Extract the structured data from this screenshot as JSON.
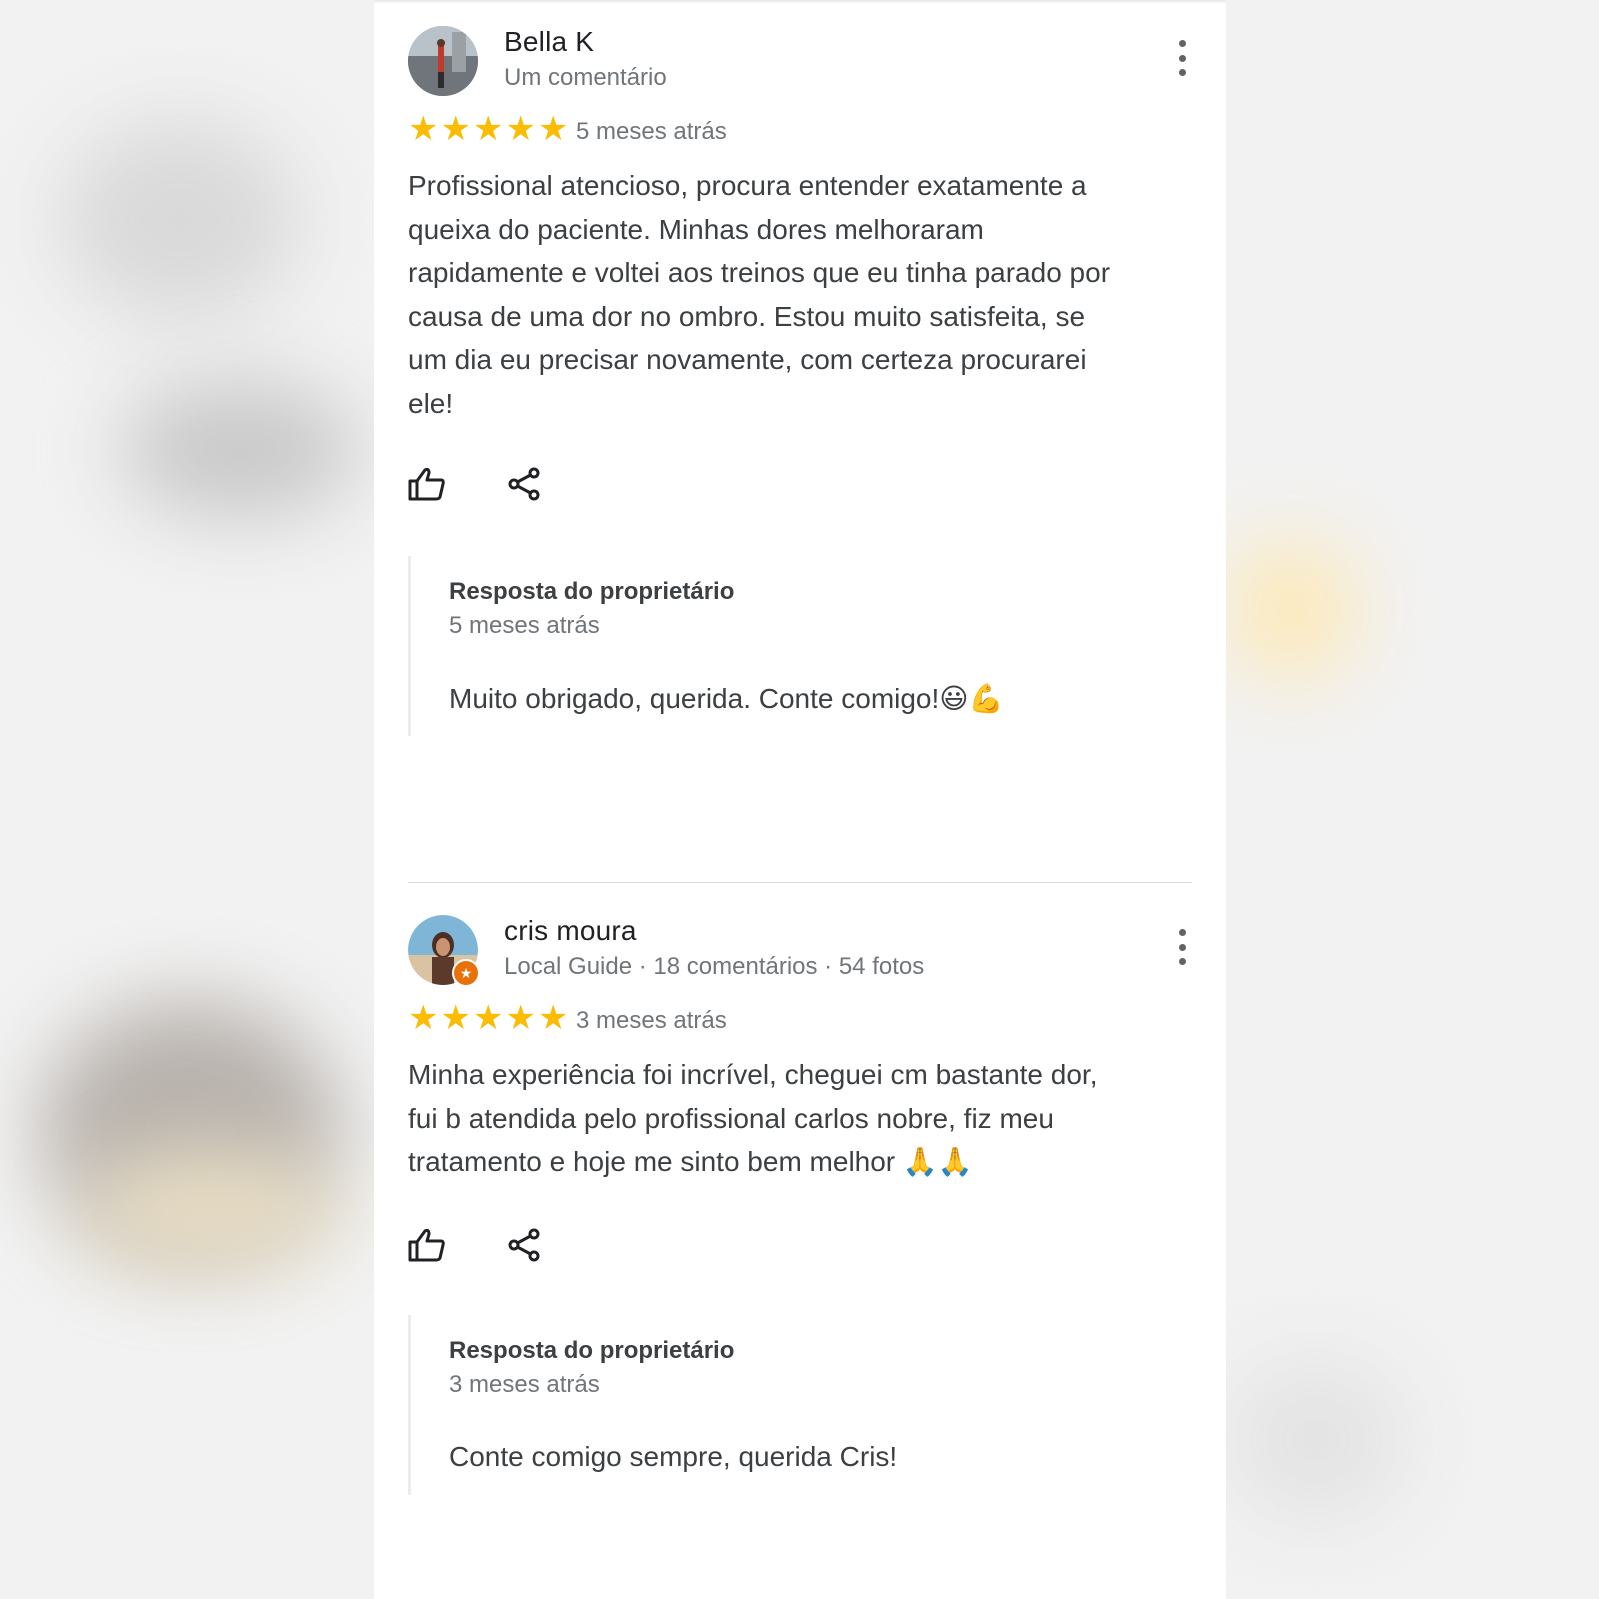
{
  "reviews": [
    {
      "name": "Bella K",
      "meta": "Um comentário",
      "rating": 5,
      "date": "5 meses atrás",
      "text": "Profissional atencioso, procura entender exatamente a queixa do paciente. Minhas dores melhoraram rapidamente e voltei aos treinos que eu tinha parado por causa de uma dor no ombro. Estou muito satisfeita, se um dia eu precisar novamente, com certeza procurarei ele!",
      "reply": {
        "title": "Resposta do proprietário",
        "date": "5 meses atrás",
        "text": "Muito obrigado, querida. Conte comigo!😃💪"
      }
    },
    {
      "name": "cris moura",
      "meta": "Local Guide · 18 comentários · 54 fotos",
      "rating": 5,
      "date": "3 meses atrás",
      "text": "Minha experiência foi incrível, cheguei cm  bastante dor, fui b atendida pelo profissional carlos nobre, fiz meu tratamento e hoje me sinto bem melhor 🙏🙏",
      "reply": {
        "title": "Resposta do proprietário",
        "date": "3 meses atrás",
        "text": "Conte comigo sempre, querida Cris!"
      }
    }
  ],
  "colors": {
    "star": "#fbbc04",
    "name": "#202124",
    "secondary": "#70757a",
    "body": "#3c4043",
    "local_guide_badge": "#e8710a"
  },
  "icons": [
    "more-vert-icon",
    "thumb-up-icon",
    "share-icon",
    "star-icon",
    "local-guide-badge-icon"
  ]
}
